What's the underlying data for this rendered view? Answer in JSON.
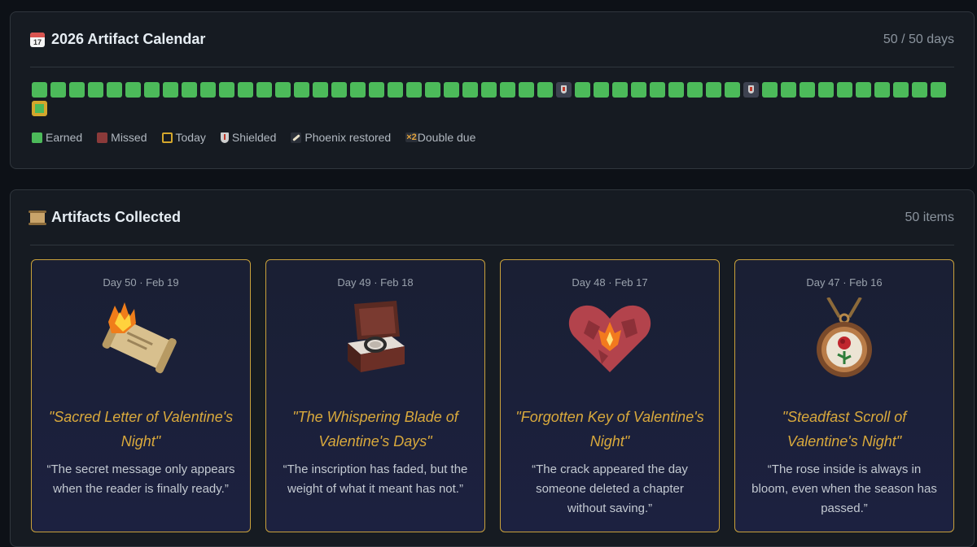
{
  "calendar": {
    "icon": "calendar-icon",
    "icon_day": "17",
    "title": "2026 Artifact Calendar",
    "count": "50 / 50 days",
    "days": [
      "earned",
      "earned",
      "earned",
      "earned",
      "earned",
      "earned",
      "earned",
      "earned",
      "earned",
      "earned",
      "earned",
      "earned",
      "earned",
      "earned",
      "earned",
      "earned",
      "earned",
      "earned",
      "earned",
      "earned",
      "earned",
      "earned",
      "earned",
      "earned",
      "earned",
      "earned",
      "earned",
      "earned",
      "shielded",
      "earned",
      "earned",
      "earned",
      "earned",
      "earned",
      "earned",
      "earned",
      "earned",
      "earned",
      "shielded",
      "earned",
      "earned",
      "earned",
      "earned",
      "earned",
      "earned",
      "earned",
      "earned",
      "earned",
      "earned",
      "today"
    ],
    "legend": {
      "earned": "Earned",
      "missed": "Missed",
      "today": "Today",
      "shielded": "Shielded",
      "phoenix": "Phoenix restored",
      "double_badge": "×2",
      "double": "Double due"
    },
    "colors": {
      "earned": "#4cba5a",
      "missed": "#8b3a3a",
      "today": "#d4a72c"
    }
  },
  "artifacts": {
    "icon": "scroll-icon",
    "title": "Artifacts Collected",
    "count": "50 items",
    "cards": [
      {
        "date": "Day 50 · Feb 19",
        "art_icon": "burning-scroll-icon",
        "name": "\"Sacred Letter of Valentine's Night\"",
        "quote": "“The secret message only appears when the reader is finally ready.”"
      },
      {
        "date": "Day 49 · Feb 18",
        "art_icon": "ring-box-icon",
        "name": "\"The Whispering Blade of Valentine's Days\"",
        "quote": "“The inscription has faded, but the weight of what it meant has not.”"
      },
      {
        "date": "Day 48 · Feb 17",
        "art_icon": "cracked-heart-icon",
        "name": "\"Forgotten Key of Valentine's Night\"",
        "quote": "“The crack appeared the day someone deleted a chapter without saving.”"
      },
      {
        "date": "Day 47 · Feb 16",
        "art_icon": "rose-locket-icon",
        "name": "\"Steadfast Scroll of Valentine's Night\"",
        "quote": "“The rose inside is always in bloom, even when the season has passed.”"
      }
    ],
    "accent": "#d9a93c"
  }
}
